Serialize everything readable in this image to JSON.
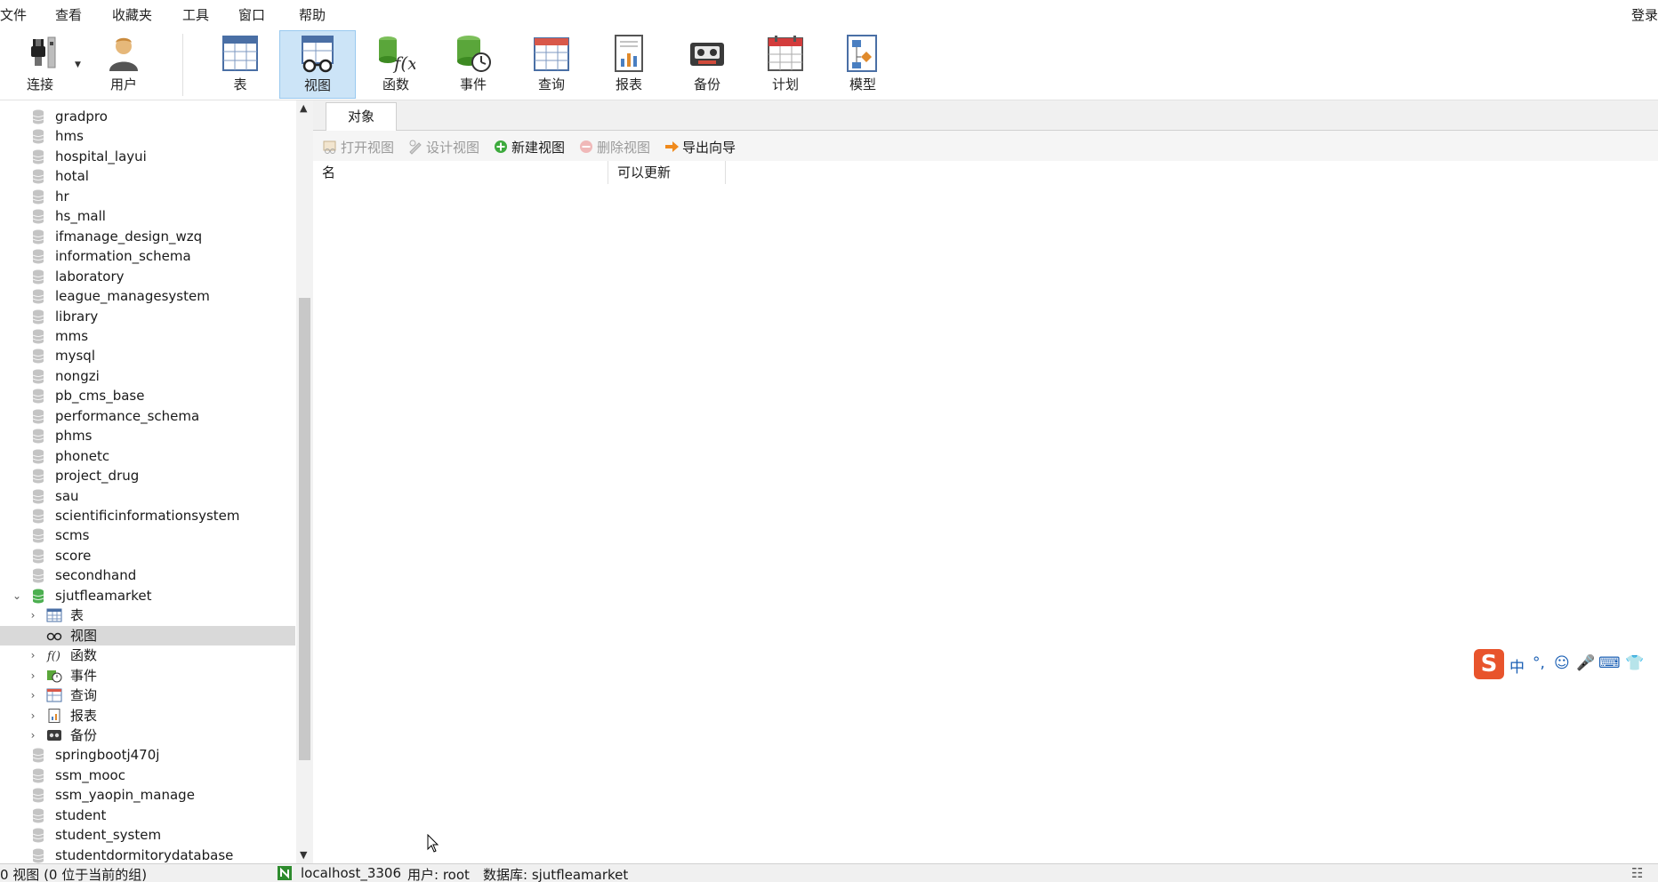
{
  "menu": {
    "items": [
      "文件",
      "查看",
      "收藏夹",
      "工具",
      "窗口",
      "帮助"
    ],
    "login": "登录"
  },
  "toolbar": {
    "connect": "连接",
    "user": "用户",
    "table": "表",
    "view": "视图",
    "function": "函数",
    "event": "事件",
    "query": "查询",
    "report": "报表",
    "backup": "备份",
    "schedule": "计划",
    "model": "模型"
  },
  "sidebar": {
    "databases_top": [
      "gradpro",
      "hms",
      "hospital_layui",
      "hotal",
      "hr",
      "hs_mall",
      "ifmanage_design_wzq",
      "information_schema",
      "laboratory",
      "league_managesystem",
      "library",
      "mms",
      "mysql",
      "nongzi",
      "pb_cms_base",
      "performance_schema",
      "phms",
      "phonetc",
      "project_drug",
      "sau",
      "scientificinformationsystem",
      "scms",
      "score",
      "secondhand"
    ],
    "open_db": "sjutfleamarket",
    "children": [
      {
        "label": "表",
        "icon": "table-icon"
      },
      {
        "label": "视图",
        "icon": "glasses-icon"
      },
      {
        "label": "函数",
        "icon": "function-icon"
      },
      {
        "label": "事件",
        "icon": "event-icon"
      },
      {
        "label": "查询",
        "icon": "query-icon"
      },
      {
        "label": "报表",
        "icon": "report-icon"
      },
      {
        "label": "备份",
        "icon": "backup-icon"
      }
    ],
    "databases_bottom": [
      "springbootj470j",
      "ssm_mooc",
      "ssm_yaopin_manage",
      "student",
      "student_system",
      "studentdormitorydatabase"
    ]
  },
  "main": {
    "tab": "对象",
    "actions": {
      "open_view": "打开视图",
      "design_view": "设计视图",
      "new_view": "新建视图",
      "delete_view": "删除视图",
      "export_wizard": "导出向导"
    },
    "columns": {
      "name": "名",
      "updatable": "可以更新"
    }
  },
  "ime": {
    "logo": "S",
    "mode": "中",
    "punct": "°,",
    "emoji": "☺",
    "voice": "🎤",
    "keyboard": "⌨",
    "skin": "👕"
  },
  "status": {
    "count": "0 视图 (0 位于当前的组)",
    "connection": "localhost_3306",
    "user": "用户: root",
    "database": "数据库: sjutfleamarket"
  },
  "colors": {
    "db_gray": "#c4c4c4",
    "db_green": "#4caf50",
    "active_tool": "#cce4f7"
  }
}
